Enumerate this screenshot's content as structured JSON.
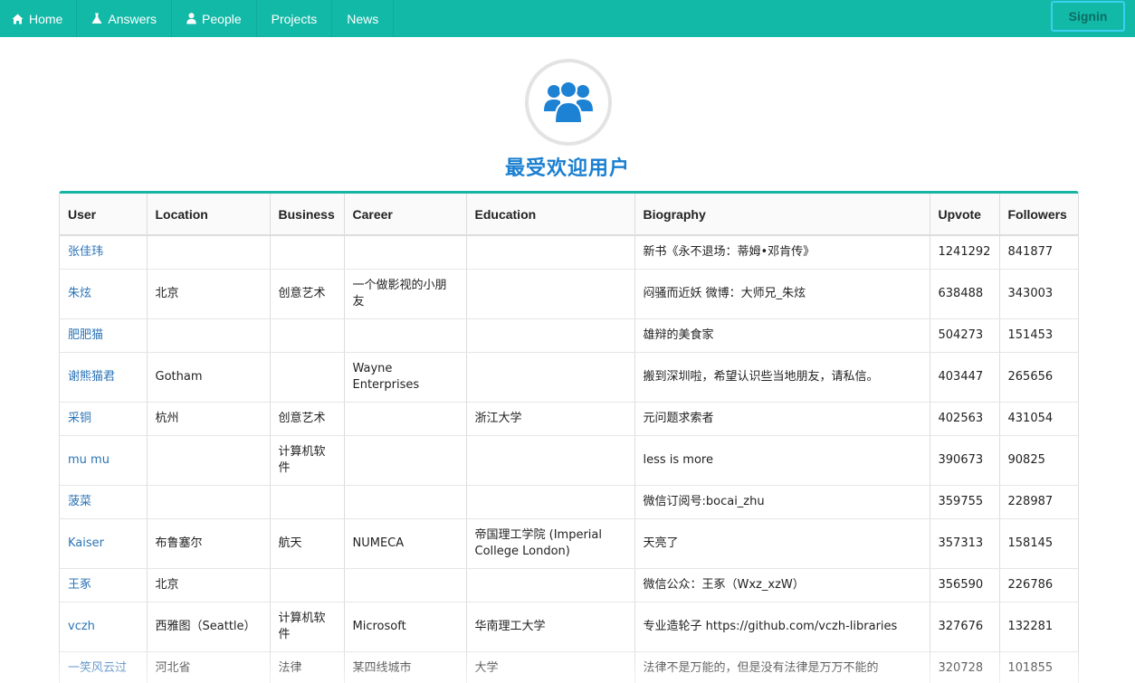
{
  "nav": {
    "items": [
      {
        "label": "Home",
        "icon": "home-icon"
      },
      {
        "label": "Answers",
        "icon": "flask-icon"
      },
      {
        "label": "People",
        "icon": "user-icon"
      },
      {
        "label": "Projects",
        "icon": ""
      },
      {
        "label": "News",
        "icon": ""
      }
    ],
    "signin_label": "Signin"
  },
  "header": {
    "icon": "users-group-icon",
    "title": "最受欢迎用户"
  },
  "table": {
    "columns": [
      "User",
      "Location",
      "Business",
      "Career",
      "Education",
      "Biography",
      "Upvote",
      "Followers"
    ],
    "rows": [
      {
        "user": "张佳玮",
        "location": "",
        "business": "",
        "career": "",
        "education": "",
        "biography": "新书《永不退场：蒂姆•邓肯传》",
        "upvote": "1241292",
        "followers": "841877"
      },
      {
        "user": "朱炫",
        "location": "北京",
        "business": "创意艺术",
        "career": "一个做影视的小朋友",
        "education": "",
        "biography": "闷骚而近妖 微博：大师兄_朱炫",
        "upvote": "638488",
        "followers": "343003"
      },
      {
        "user": "肥肥猫",
        "location": "",
        "business": "",
        "career": "",
        "education": "",
        "biography": "雄辩的美食家",
        "upvote": "504273",
        "followers": "151453"
      },
      {
        "user": "谢熊猫君",
        "location": "Gotham",
        "business": "",
        "career": "Wayne Enterprises",
        "education": "",
        "biography": "搬到深圳啦，希望认识些当地朋友，请私信。",
        "upvote": "403447",
        "followers": "265656"
      },
      {
        "user": "采铜",
        "location": "杭州",
        "business": "创意艺术",
        "career": "",
        "education": "浙江大学",
        "biography": "元问题求索者",
        "upvote": "402563",
        "followers": "431054"
      },
      {
        "user": "mu mu",
        "location": "",
        "business": "计算机软件",
        "career": "",
        "education": "",
        "biography": "less is more",
        "upvote": "390673",
        "followers": "90825"
      },
      {
        "user": "菠菜",
        "location": "",
        "business": "",
        "career": "",
        "education": "",
        "biography": "微信订阅号:bocai_zhu",
        "upvote": "359755",
        "followers": "228987"
      },
      {
        "user": "Kaiser",
        "location": "布鲁塞尔",
        "business": "航天",
        "career": "NUMECA",
        "education": "帝国理工学院 (Imperial College London)",
        "biography": "天亮了",
        "upvote": "357313",
        "followers": "158145"
      },
      {
        "user": "王豖",
        "location": "北京",
        "business": "",
        "career": "",
        "education": "",
        "biography": "微信公众：王豖（Wxz_xzW）",
        "upvote": "356590",
        "followers": "226786"
      },
      {
        "user": "vczh",
        "location": "西雅图（Seattle）",
        "business": "计算机软件",
        "career": "Microsoft",
        "education": "华南理工大学",
        "biography": "专业造轮子 https://github.com/vczh-libraries",
        "upvote": "327676",
        "followers": "132281"
      },
      {
        "user": "一笑风云过",
        "location": "河北省",
        "business": "法律",
        "career": "某四线城市",
        "education": "大学",
        "biography": "法律不是万能的，但是没有法律是万万不能的",
        "upvote": "320728",
        "followers": "101855"
      }
    ]
  }
}
